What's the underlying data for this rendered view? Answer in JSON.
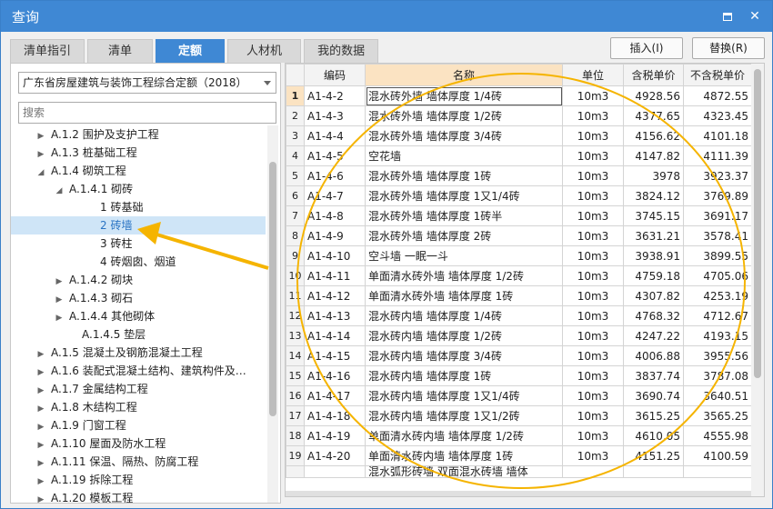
{
  "window": {
    "title": "查询",
    "max_icon": "maximize-icon",
    "close_icon": "close-icon"
  },
  "tabs": [
    {
      "label": "清单指引"
    },
    {
      "label": "清单"
    },
    {
      "label": "定额"
    },
    {
      "label": "人材机"
    },
    {
      "label": "我的数据"
    }
  ],
  "buttons": {
    "insert": "插入(I)",
    "replace": "替换(R)"
  },
  "left_panel": {
    "quota_library": "广东省房屋建筑与装饰工程综合定额（2018）",
    "search_placeholder": "搜索",
    "tree": [
      {
        "label": "A.1.2 围护及支护工程",
        "caret": "▶"
      },
      {
        "label": "A.1.3 桩基础工程",
        "caret": "▶"
      },
      {
        "label": "A.1.4 砌筑工程",
        "caret": "◢"
      },
      {
        "label": "A.1.4.1 砌砖",
        "caret": "◢"
      },
      {
        "label": "1 砖基础",
        "caret": ""
      },
      {
        "label": "2 砖墙",
        "caret": ""
      },
      {
        "label": "3 砖柱",
        "caret": ""
      },
      {
        "label": "4 砖烟囱、烟道",
        "caret": ""
      },
      {
        "label": "A.1.4.2 砌块",
        "caret": "▶"
      },
      {
        "label": "A.1.4.3 砌石",
        "caret": "▶"
      },
      {
        "label": "A.1.4.4 其他砌体",
        "caret": "▶"
      },
      {
        "label": "A.1.4.5 垫层",
        "caret": ""
      },
      {
        "label": "A.1.5 混凝土及钢筋混凝土工程",
        "caret": "▶"
      },
      {
        "label": "A.1.6 装配式混凝土结构、建筑构件及…",
        "caret": "▶"
      },
      {
        "label": "A.1.7 金属结构工程",
        "caret": "▶"
      },
      {
        "label": "A.1.8 木结构工程",
        "caret": "▶"
      },
      {
        "label": "A.1.9 门窗工程",
        "caret": "▶"
      },
      {
        "label": "A.1.10 屋面及防水工程",
        "caret": "▶"
      },
      {
        "label": "A.1.11 保温、隔热、防腐工程",
        "caret": "▶"
      },
      {
        "label": "A.1.19 拆除工程",
        "caret": "▶"
      },
      {
        "label": "A.1.20 模板工程",
        "caret": "▶"
      }
    ]
  },
  "grid": {
    "columns": [
      "编码",
      "名称",
      "单位",
      "含税单价",
      "不含税单价"
    ],
    "rows": [
      {
        "idx": "1",
        "code": "A1-4-2",
        "name": "混水砖外墙 墙体厚度 1/4砖",
        "unit": "10m3",
        "tax": "4928.56",
        "notax": "4872.55"
      },
      {
        "idx": "2",
        "code": "A1-4-3",
        "name": "混水砖外墙 墙体厚度 1/2砖",
        "unit": "10m3",
        "tax": "4377.65",
        "notax": "4323.45"
      },
      {
        "idx": "3",
        "code": "A1-4-4",
        "name": "混水砖外墙 墙体厚度 3/4砖",
        "unit": "10m3",
        "tax": "4156.62",
        "notax": "4101.18"
      },
      {
        "idx": "4",
        "code": "A1-4-5",
        "name": "空花墙",
        "unit": "10m3",
        "tax": "4147.82",
        "notax": "4111.39"
      },
      {
        "idx": "5",
        "code": "A1-4-6",
        "name": "混水砖外墙 墙体厚度 1砖",
        "unit": "10m3",
        "tax": "3978",
        "notax": "3923.37"
      },
      {
        "idx": "6",
        "code": "A1-4-7",
        "name": "混水砖外墙 墙体厚度 1又1/4砖",
        "unit": "10m3",
        "tax": "3824.12",
        "notax": "3769.89"
      },
      {
        "idx": "7",
        "code": "A1-4-8",
        "name": "混水砖外墙 墙体厚度 1砖半",
        "unit": "10m3",
        "tax": "3745.15",
        "notax": "3691.17"
      },
      {
        "idx": "8",
        "code": "A1-4-9",
        "name": "混水砖外墙 墙体厚度 2砖",
        "unit": "10m3",
        "tax": "3631.21",
        "notax": "3578.41"
      },
      {
        "idx": "9",
        "code": "A1-4-10",
        "name": "空斗墙 一眠一斗",
        "unit": "10m3",
        "tax": "3938.91",
        "notax": "3899.55"
      },
      {
        "idx": "10",
        "code": "A1-4-11",
        "name": "单面清水砖外墙 墙体厚度 1/2砖",
        "unit": "10m3",
        "tax": "4759.18",
        "notax": "4705.06"
      },
      {
        "idx": "11",
        "code": "A1-4-12",
        "name": "单面清水砖外墙 墙体厚度 1砖",
        "unit": "10m3",
        "tax": "4307.82",
        "notax": "4253.19"
      },
      {
        "idx": "12",
        "code": "A1-4-13",
        "name": "混水砖内墙 墙体厚度 1/4砖",
        "unit": "10m3",
        "tax": "4768.32",
        "notax": "4712.67"
      },
      {
        "idx": "13",
        "code": "A1-4-14",
        "name": "混水砖内墙 墙体厚度 1/2砖",
        "unit": "10m3",
        "tax": "4247.22",
        "notax": "4193.15"
      },
      {
        "idx": "14",
        "code": "A1-4-15",
        "name": "混水砖内墙 墙体厚度 3/4砖",
        "unit": "10m3",
        "tax": "4006.88",
        "notax": "3955.56"
      },
      {
        "idx": "15",
        "code": "A1-4-16",
        "name": "混水砖内墙 墙体厚度 1砖",
        "unit": "10m3",
        "tax": "3837.74",
        "notax": "3787.08"
      },
      {
        "idx": "16",
        "code": "A1-4-17",
        "name": "混水砖内墙 墙体厚度 1又1/4砖",
        "unit": "10m3",
        "tax": "3690.74",
        "notax": "3640.51"
      },
      {
        "idx": "17",
        "code": "A1-4-18",
        "name": "混水砖内墙 墙体厚度 1又1/2砖",
        "unit": "10m3",
        "tax": "3615.25",
        "notax": "3565.25"
      },
      {
        "idx": "18",
        "code": "A1-4-19",
        "name": "单面清水砖内墙 墙体厚度 1/2砖",
        "unit": "10m3",
        "tax": "4610.05",
        "notax": "4555.98"
      },
      {
        "idx": "19",
        "code": "A1-4-20",
        "name": "单面清水砖内墙 墙体厚度 1砖",
        "unit": "10m3",
        "tax": "4151.25",
        "notax": "4100.59"
      }
    ],
    "partial_row_name": "混水弧形砖墙 双面混水砖墙 墙体"
  },
  "colors": {
    "accent": "#3f88d4",
    "annotation": "#f5b400",
    "selection": "#cfe5f7"
  }
}
